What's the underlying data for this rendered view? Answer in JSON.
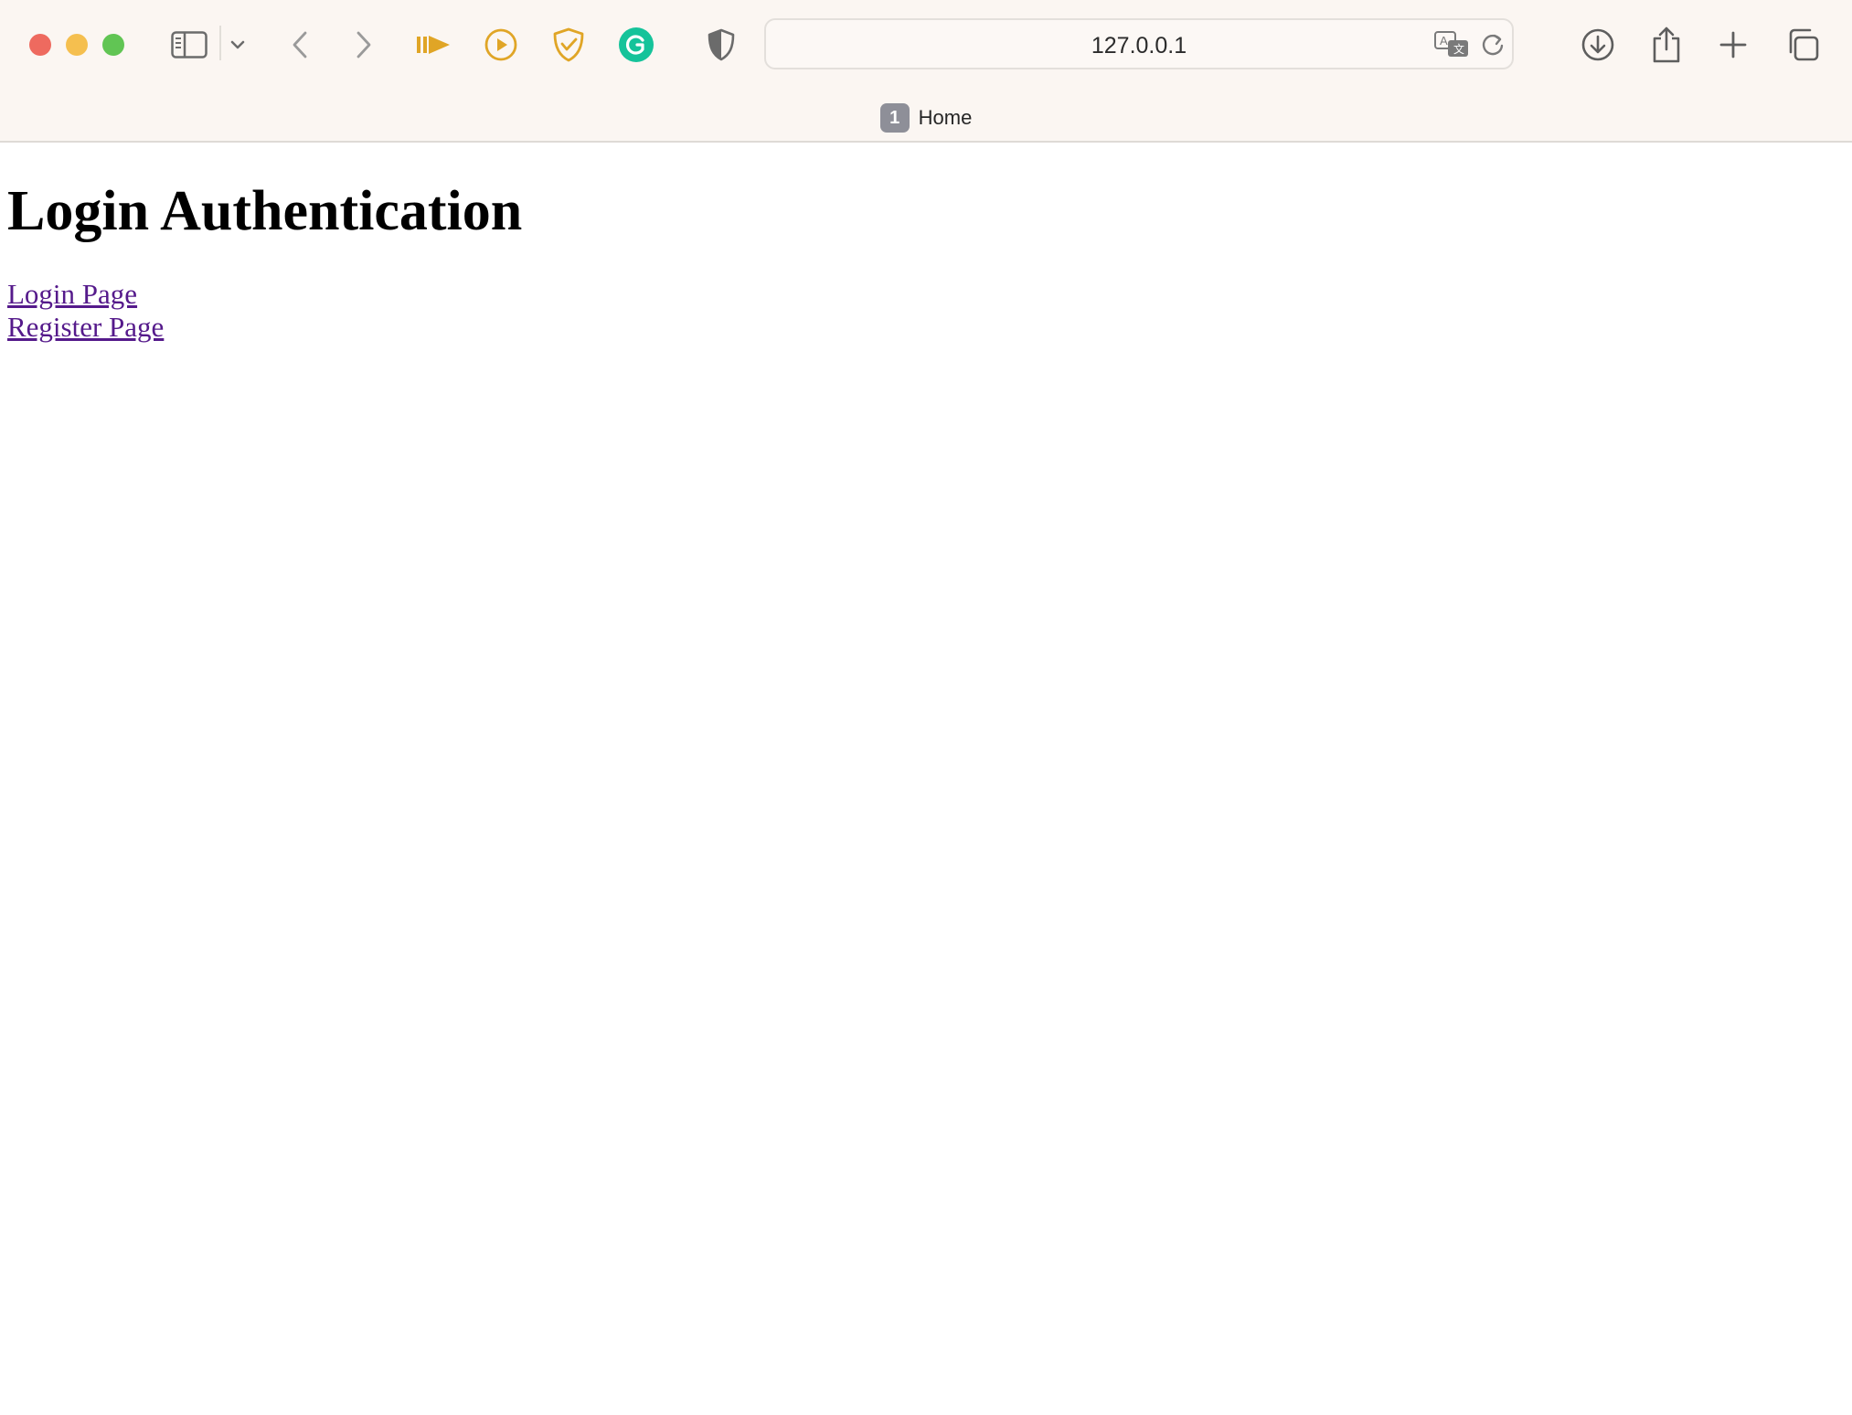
{
  "browser": {
    "url": "127.0.0.1",
    "tabs": [
      {
        "index": "1",
        "title": "Home"
      }
    ],
    "colors": {
      "close": "#ee6a5f",
      "minimize": "#f5bf4f",
      "maximize": "#61c554",
      "extension_accent": "#e0a526",
      "grammarly": "#15c39a"
    },
    "icons": [
      "sidebar-toggle-icon",
      "chevron-down-icon",
      "back-arrow-icon",
      "forward-arrow-icon",
      "audio-extension-icon",
      "play-extension-icon",
      "shield-check-icon",
      "grammarly-icon",
      "privacy-shield-icon",
      "translate-icon",
      "reload-icon",
      "download-icon",
      "share-icon",
      "new-tab-icon",
      "tab-overview-icon"
    ]
  },
  "page": {
    "heading": "Login Authentication",
    "links": [
      {
        "label": "Login Page"
      },
      {
        "label": "Register Page"
      }
    ]
  }
}
